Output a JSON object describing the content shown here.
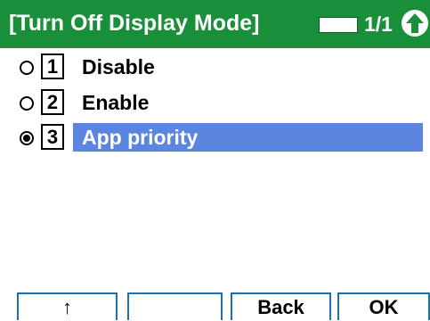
{
  "header": {
    "title": "[Turn Off Display Mode]",
    "page_indicator": "1/1",
    "scroll_icon": "up-arrow-icon",
    "color": "#1a8f3a"
  },
  "list": {
    "items": [
      {
        "number": "1",
        "label": "Disable",
        "checked": false
      },
      {
        "number": "2",
        "label": "Enable",
        "checked": false
      },
      {
        "number": "3",
        "label": "App priority",
        "checked": true
      }
    ],
    "selection_color": "#5b85e0"
  },
  "softkeys": {
    "key1_label": "↑",
    "key2_label": "",
    "key3_label": "Back",
    "key4_label": "OK",
    "border_color": "#1f6fb0"
  }
}
